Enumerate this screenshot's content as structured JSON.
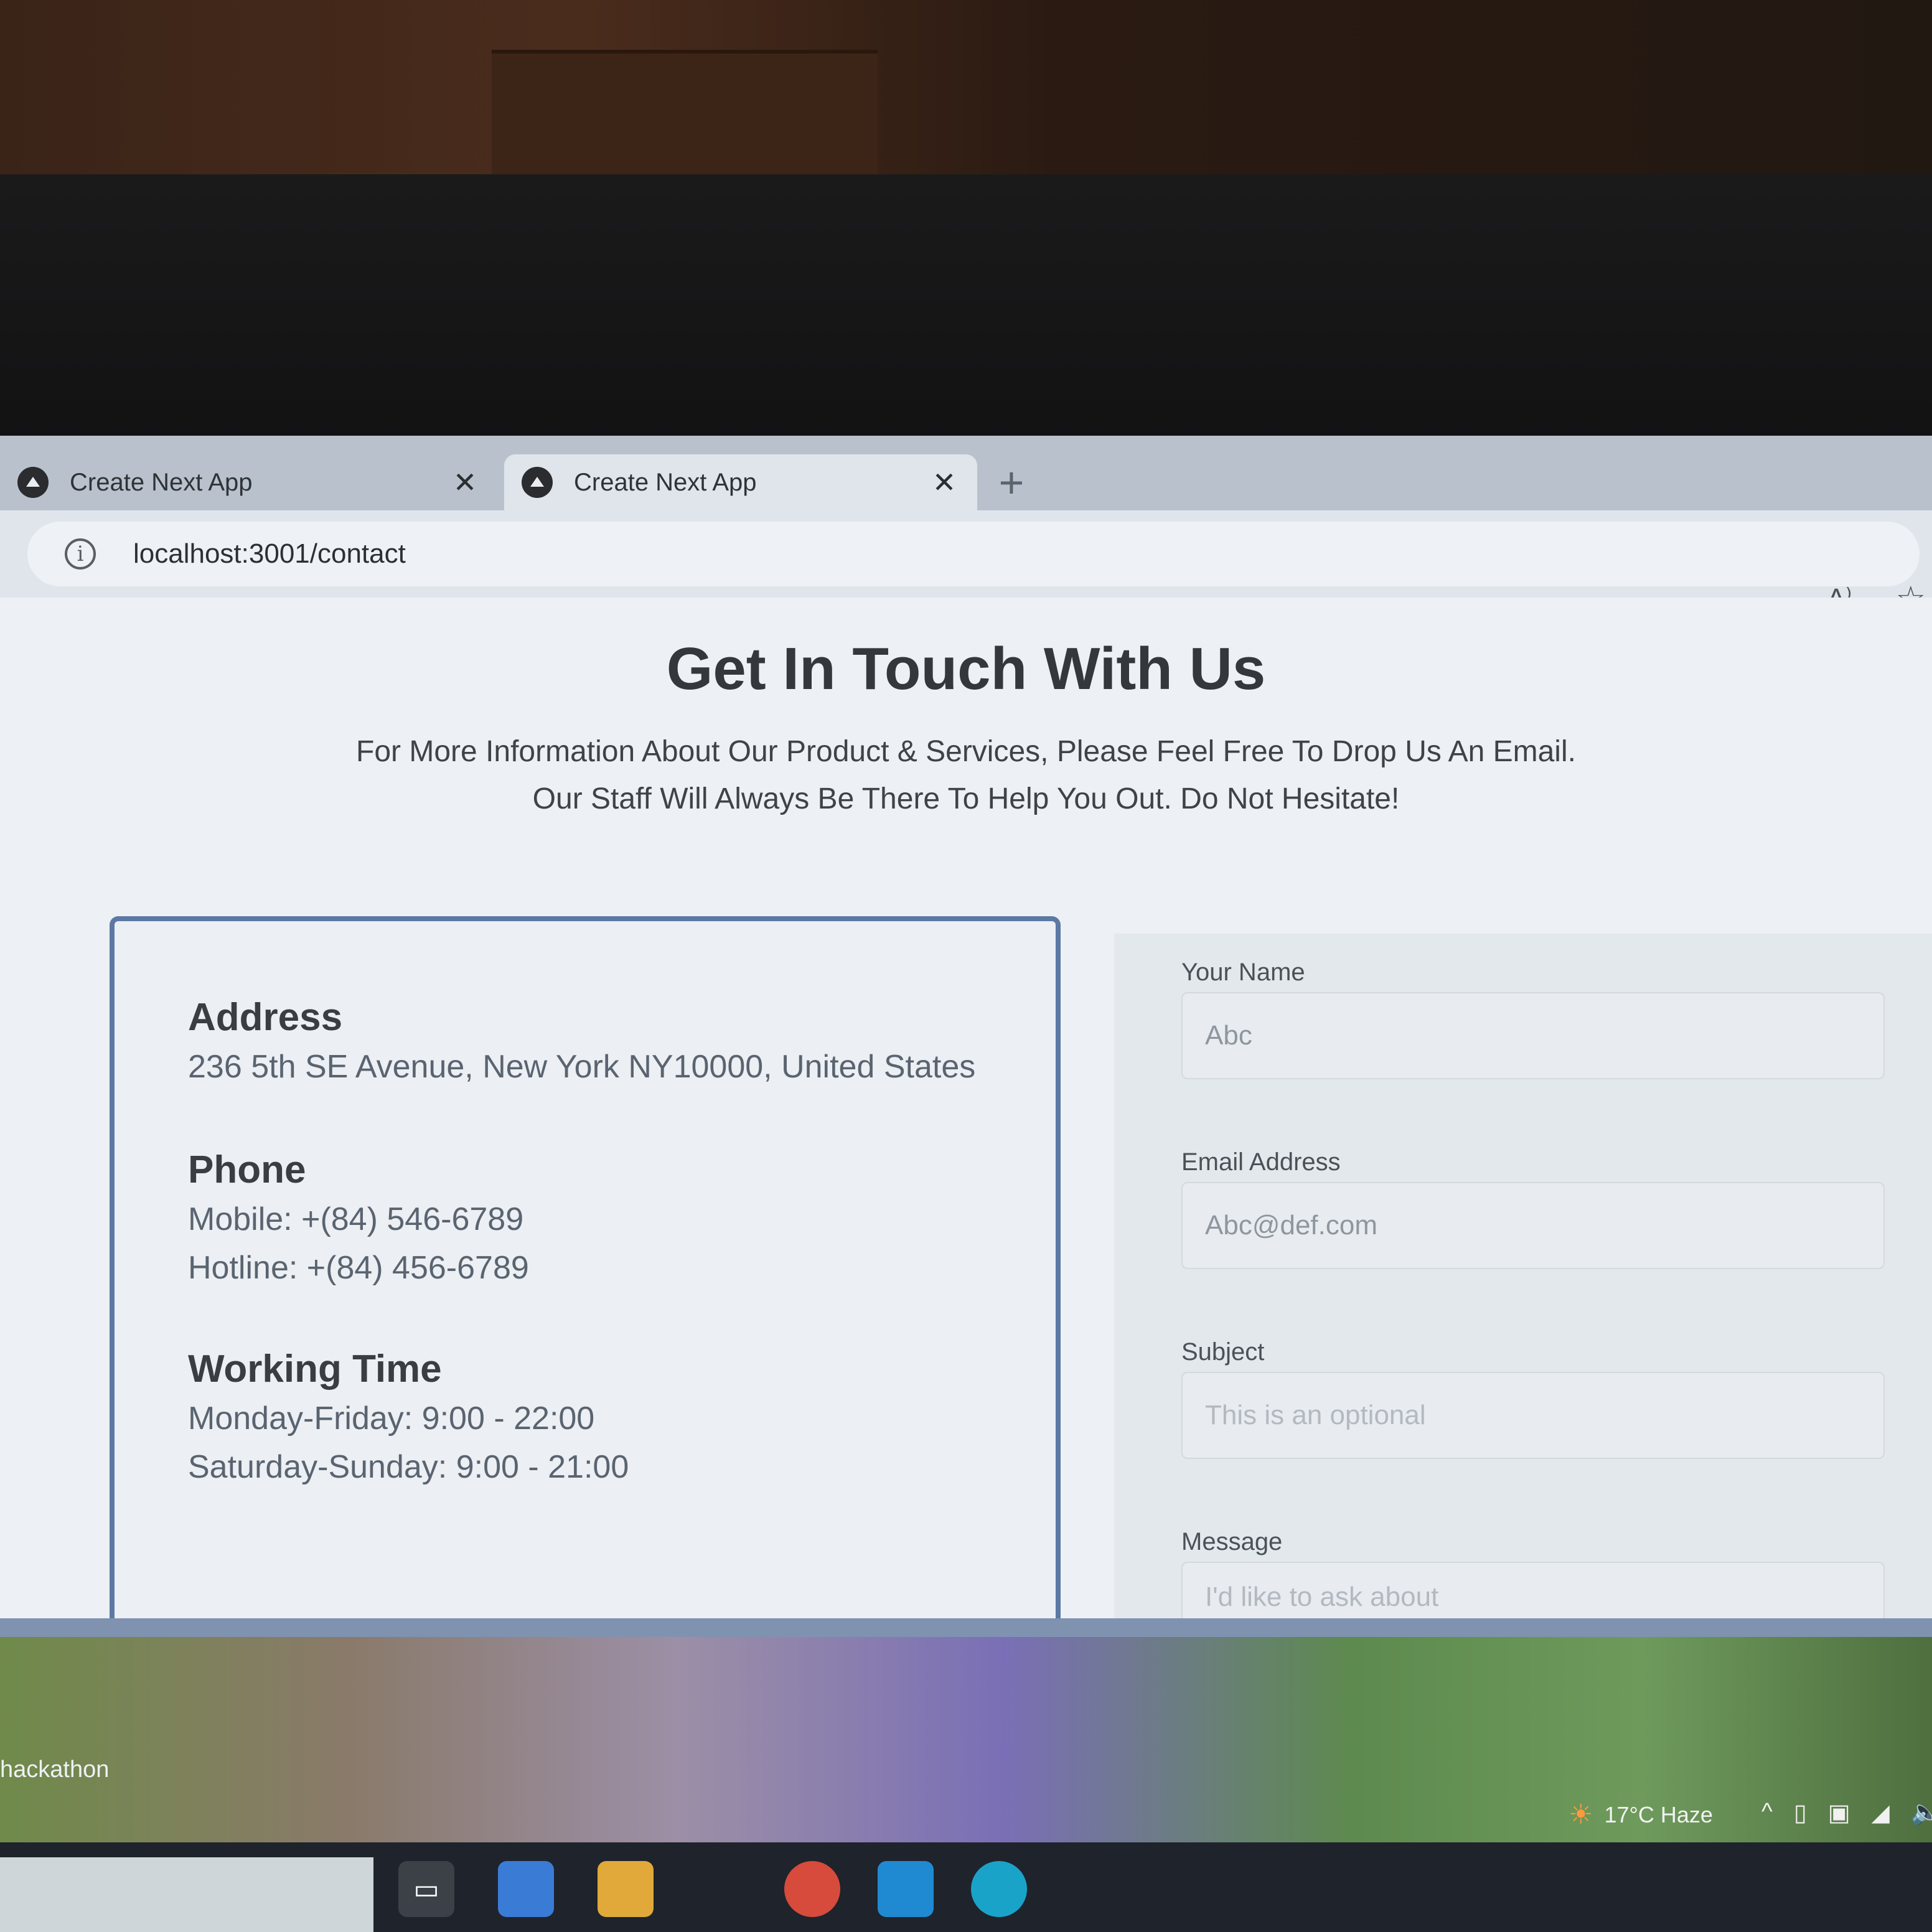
{
  "browser": {
    "tabs": [
      {
        "title": "Create Next App",
        "close": "✕"
      },
      {
        "title": "Create Next App",
        "close": "✕"
      }
    ],
    "new_tab": "+",
    "url": "localhost:3001/contact",
    "read_aloud": "A⁾",
    "favorite": "☆",
    "info": "i"
  },
  "page": {
    "heading": "Get In Touch With Us",
    "intro_line1": "For More Information About Our Product & Services, Please Feel Free To Drop Us An Email.",
    "intro_line2": "Our Staff Will Always Be There To Help You Out. Do Not Hesitate!"
  },
  "contact_info": {
    "address": {
      "title": "Address",
      "value": "236 5th SE Avenue, New York NY10000, United States"
    },
    "phone": {
      "title": "Phone",
      "mobile": "Mobile: +(84) 546-6789",
      "hotline": "Hotline: +(84) 456-6789"
    },
    "working_time": {
      "title": "Working Time",
      "weekdays": "Monday-Friday: 9:00 - 22:00",
      "weekend": "Saturday-Sunday: 9:00 - 21:00"
    }
  },
  "form": {
    "name": {
      "label": "Your Name",
      "placeholder": "Abc"
    },
    "email": {
      "label": "Email Address",
      "placeholder": "Abc@def.com"
    },
    "subject": {
      "label": "Subject",
      "placeholder": "This is an optional"
    },
    "message": {
      "label": "Message",
      "placeholder": "I'd like to ask about"
    }
  },
  "desktop": {
    "label": "hackathon",
    "weather": "17°C  Haze",
    "weather_icon": "sun-cloud-icon",
    "tray": [
      "^",
      "▯",
      "▣",
      "◢",
      "🔈"
    ]
  }
}
